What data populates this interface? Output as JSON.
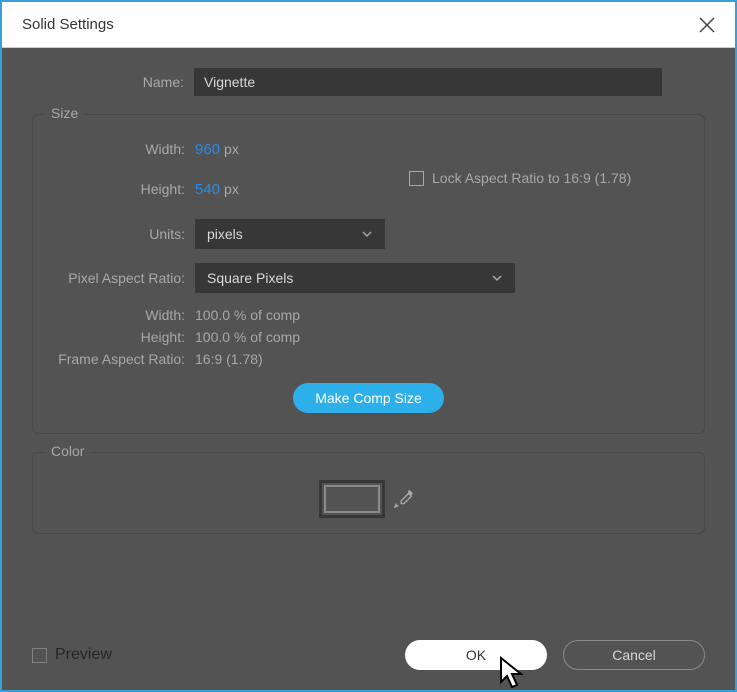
{
  "title": "Solid Settings",
  "name": {
    "label": "Name:",
    "value": "Vignette"
  },
  "size": {
    "legend": "Size",
    "width_label": "Width:",
    "width_value": "960",
    "height_label": "Height:",
    "height_value": "540",
    "px_unit": "px",
    "lock_label": "Lock Aspect Ratio to 16:9 (1.78)",
    "units_label": "Units:",
    "units_value": "pixels",
    "par_label": "Pixel Aspect Ratio:",
    "par_value": "Square Pixels",
    "info_width_label": "Width:",
    "info_width_value": "100.0 % of comp",
    "info_height_label": "Height:",
    "info_height_value": "100.0 % of comp",
    "info_far_label": "Frame Aspect Ratio:",
    "info_far_value": "16:9 (1.78)",
    "comp_btn": "Make Comp Size"
  },
  "color": {
    "legend": "Color",
    "swatch_hex": "#535353"
  },
  "footer": {
    "preview": "Preview",
    "ok": "OK",
    "cancel": "Cancel"
  }
}
